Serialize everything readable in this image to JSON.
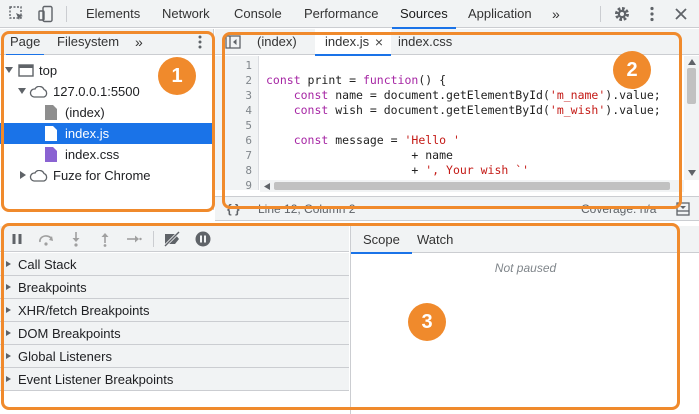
{
  "toolbar": {
    "tabs": [
      "Elements",
      "Network",
      "Console",
      "Performance",
      "Sources",
      "Application"
    ],
    "more": "»",
    "icons": [
      "inspect-element-icon",
      "device-toolbar-icon",
      "settings-gear-icon",
      "more-options-icon",
      "close-icon"
    ]
  },
  "navigator": {
    "tabs": [
      "Page",
      "Filesystem"
    ],
    "more": "»",
    "tree": {
      "top": "top",
      "host": "127.0.0.1:5500",
      "files": [
        "(index)",
        "index.js",
        "index.css"
      ],
      "selected": "index.js",
      "extension": "Fuze for Chrome"
    }
  },
  "editor": {
    "tabs": [
      "(index)",
      "index.js",
      "index.css"
    ],
    "close_glyph": "×",
    "line_numbers": [
      "1",
      "2",
      "3",
      "4",
      "5",
      "6",
      "7",
      "8",
      "9"
    ],
    "code": [
      "",
      "const print = function() {",
      "    const name = document.getElementById('m_name').value;",
      "    const wish = document.getElementById('m_wish').value;",
      "",
      "    const message = 'Hello '",
      "                     + name",
      "                     + ', Your wish `'",
      ""
    ],
    "status": {
      "braces": "{ }",
      "position": "Line 12, Column 2",
      "coverage": "Coverage: n/a"
    }
  },
  "debugger": {
    "panes": [
      "Call Stack",
      "Breakpoints",
      "XHR/fetch Breakpoints",
      "DOM Breakpoints",
      "Global Listeners",
      "Event Listener Breakpoints"
    ],
    "scope_tabs": [
      "Scope",
      "Watch"
    ],
    "not_paused": "Not paused"
  },
  "annotations": [
    "1",
    "2",
    "3"
  ],
  "colors": {
    "accent": "#1a73e8",
    "annotation": "#f08a2c",
    "keyword": "#a626a4",
    "string": "#c41a16"
  }
}
